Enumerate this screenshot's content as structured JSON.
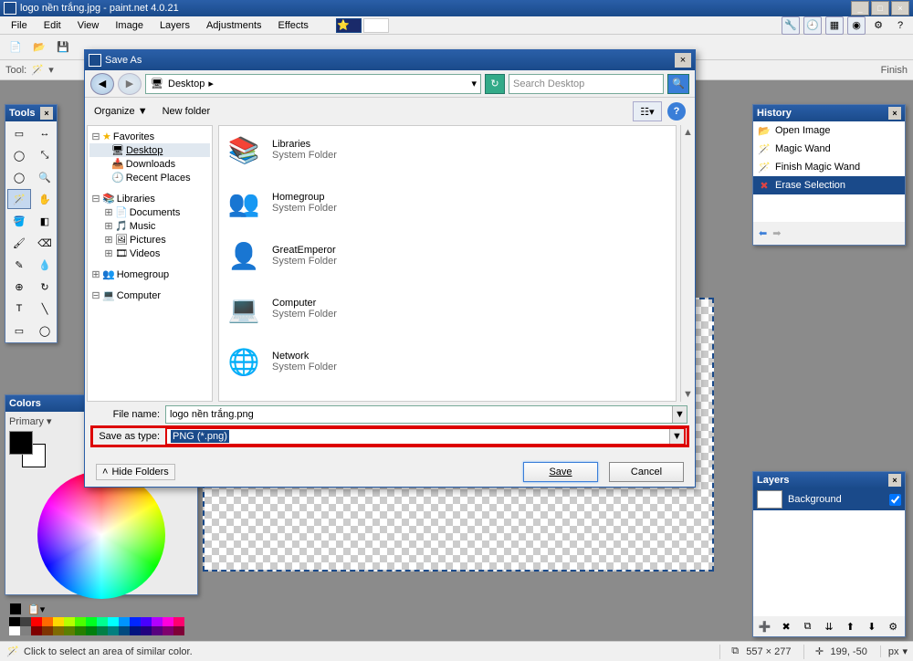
{
  "app": {
    "title": "logo nền trắng.jpg - paint.net 4.0.21",
    "menu": [
      "File",
      "Edit",
      "View",
      "Image",
      "Layers",
      "Adjustments",
      "Effects"
    ]
  },
  "toolrow": {
    "label": "Tool:",
    "finish": "Finish"
  },
  "tools_panel": {
    "title": "Tools"
  },
  "colors_panel": {
    "title": "Colors",
    "primary": "Primary"
  },
  "history_panel": {
    "title": "History",
    "items": [
      "Open Image",
      "Magic Wand",
      "Finish Magic Wand",
      "Erase Selection"
    ]
  },
  "layers_panel": {
    "title": "Layers",
    "items": [
      "Background"
    ]
  },
  "dialog": {
    "title": "Save As",
    "location": "Desktop",
    "search_placeholder": "Search Desktop",
    "organize": "Organize",
    "new_folder": "New folder",
    "tree": {
      "favorites": "Favorites",
      "fav_items": [
        "Desktop",
        "Downloads",
        "Recent Places"
      ],
      "libraries": "Libraries",
      "lib_items": [
        "Documents",
        "Music",
        "Pictures",
        "Videos"
      ],
      "homegroup": "Homegroup",
      "computer": "Computer"
    },
    "files": [
      {
        "name": "Libraries",
        "sub": "System Folder"
      },
      {
        "name": "Homegroup",
        "sub": "System Folder"
      },
      {
        "name": "GreatEmperor",
        "sub": "System Folder"
      },
      {
        "name": "Computer",
        "sub": "System Folder"
      },
      {
        "name": "Network",
        "sub": "System Folder"
      }
    ],
    "filename_label": "File name:",
    "filename": "logo nền trắng.png",
    "type_label": "Save as type:",
    "type": "PNG (*.png)",
    "hide_folders": "Hide Folders",
    "save": "Save",
    "cancel": "Cancel"
  },
  "status": {
    "hint": "Click to select an area of similar color.",
    "size": "557 × 277",
    "cursor": "199, -50",
    "unit": "px"
  }
}
